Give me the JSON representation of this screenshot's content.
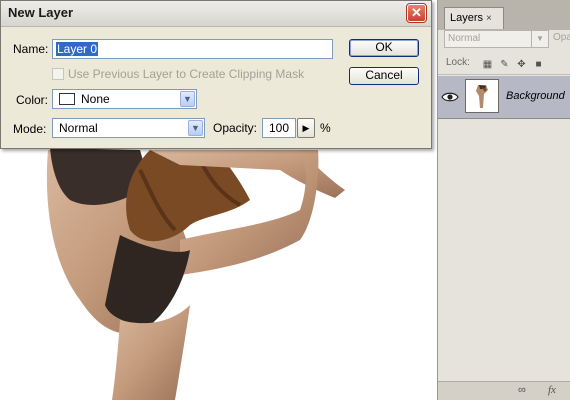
{
  "dialog": {
    "title": "New Layer",
    "name_label": "Name:",
    "name_value": "Layer 0",
    "ok_label": "OK",
    "cancel_label": "Cancel",
    "clipping_label": "Use Previous Layer to Create Clipping Mask",
    "clipping_checked": false,
    "color_label": "Color:",
    "color_value": "None",
    "mode_label": "Mode:",
    "mode_value": "Normal",
    "opacity_label": "Opacity:",
    "opacity_value": "100",
    "opacity_unit": "%"
  },
  "layers_panel": {
    "tab_label": "Layers",
    "tab_close": "×",
    "blend_mode": "Normal",
    "opacity_label": "Opa",
    "lock_label": "Lock:",
    "layers": [
      {
        "name": "Background",
        "visible": true
      }
    ],
    "bottom_link_icon": "∞",
    "bottom_fx_label": "fx"
  },
  "colors": {
    "dialog_bg": "#ece9d8",
    "selection": "#316ac5",
    "layer_selected": "#b6b8c6",
    "close_button": "#c6432c"
  }
}
